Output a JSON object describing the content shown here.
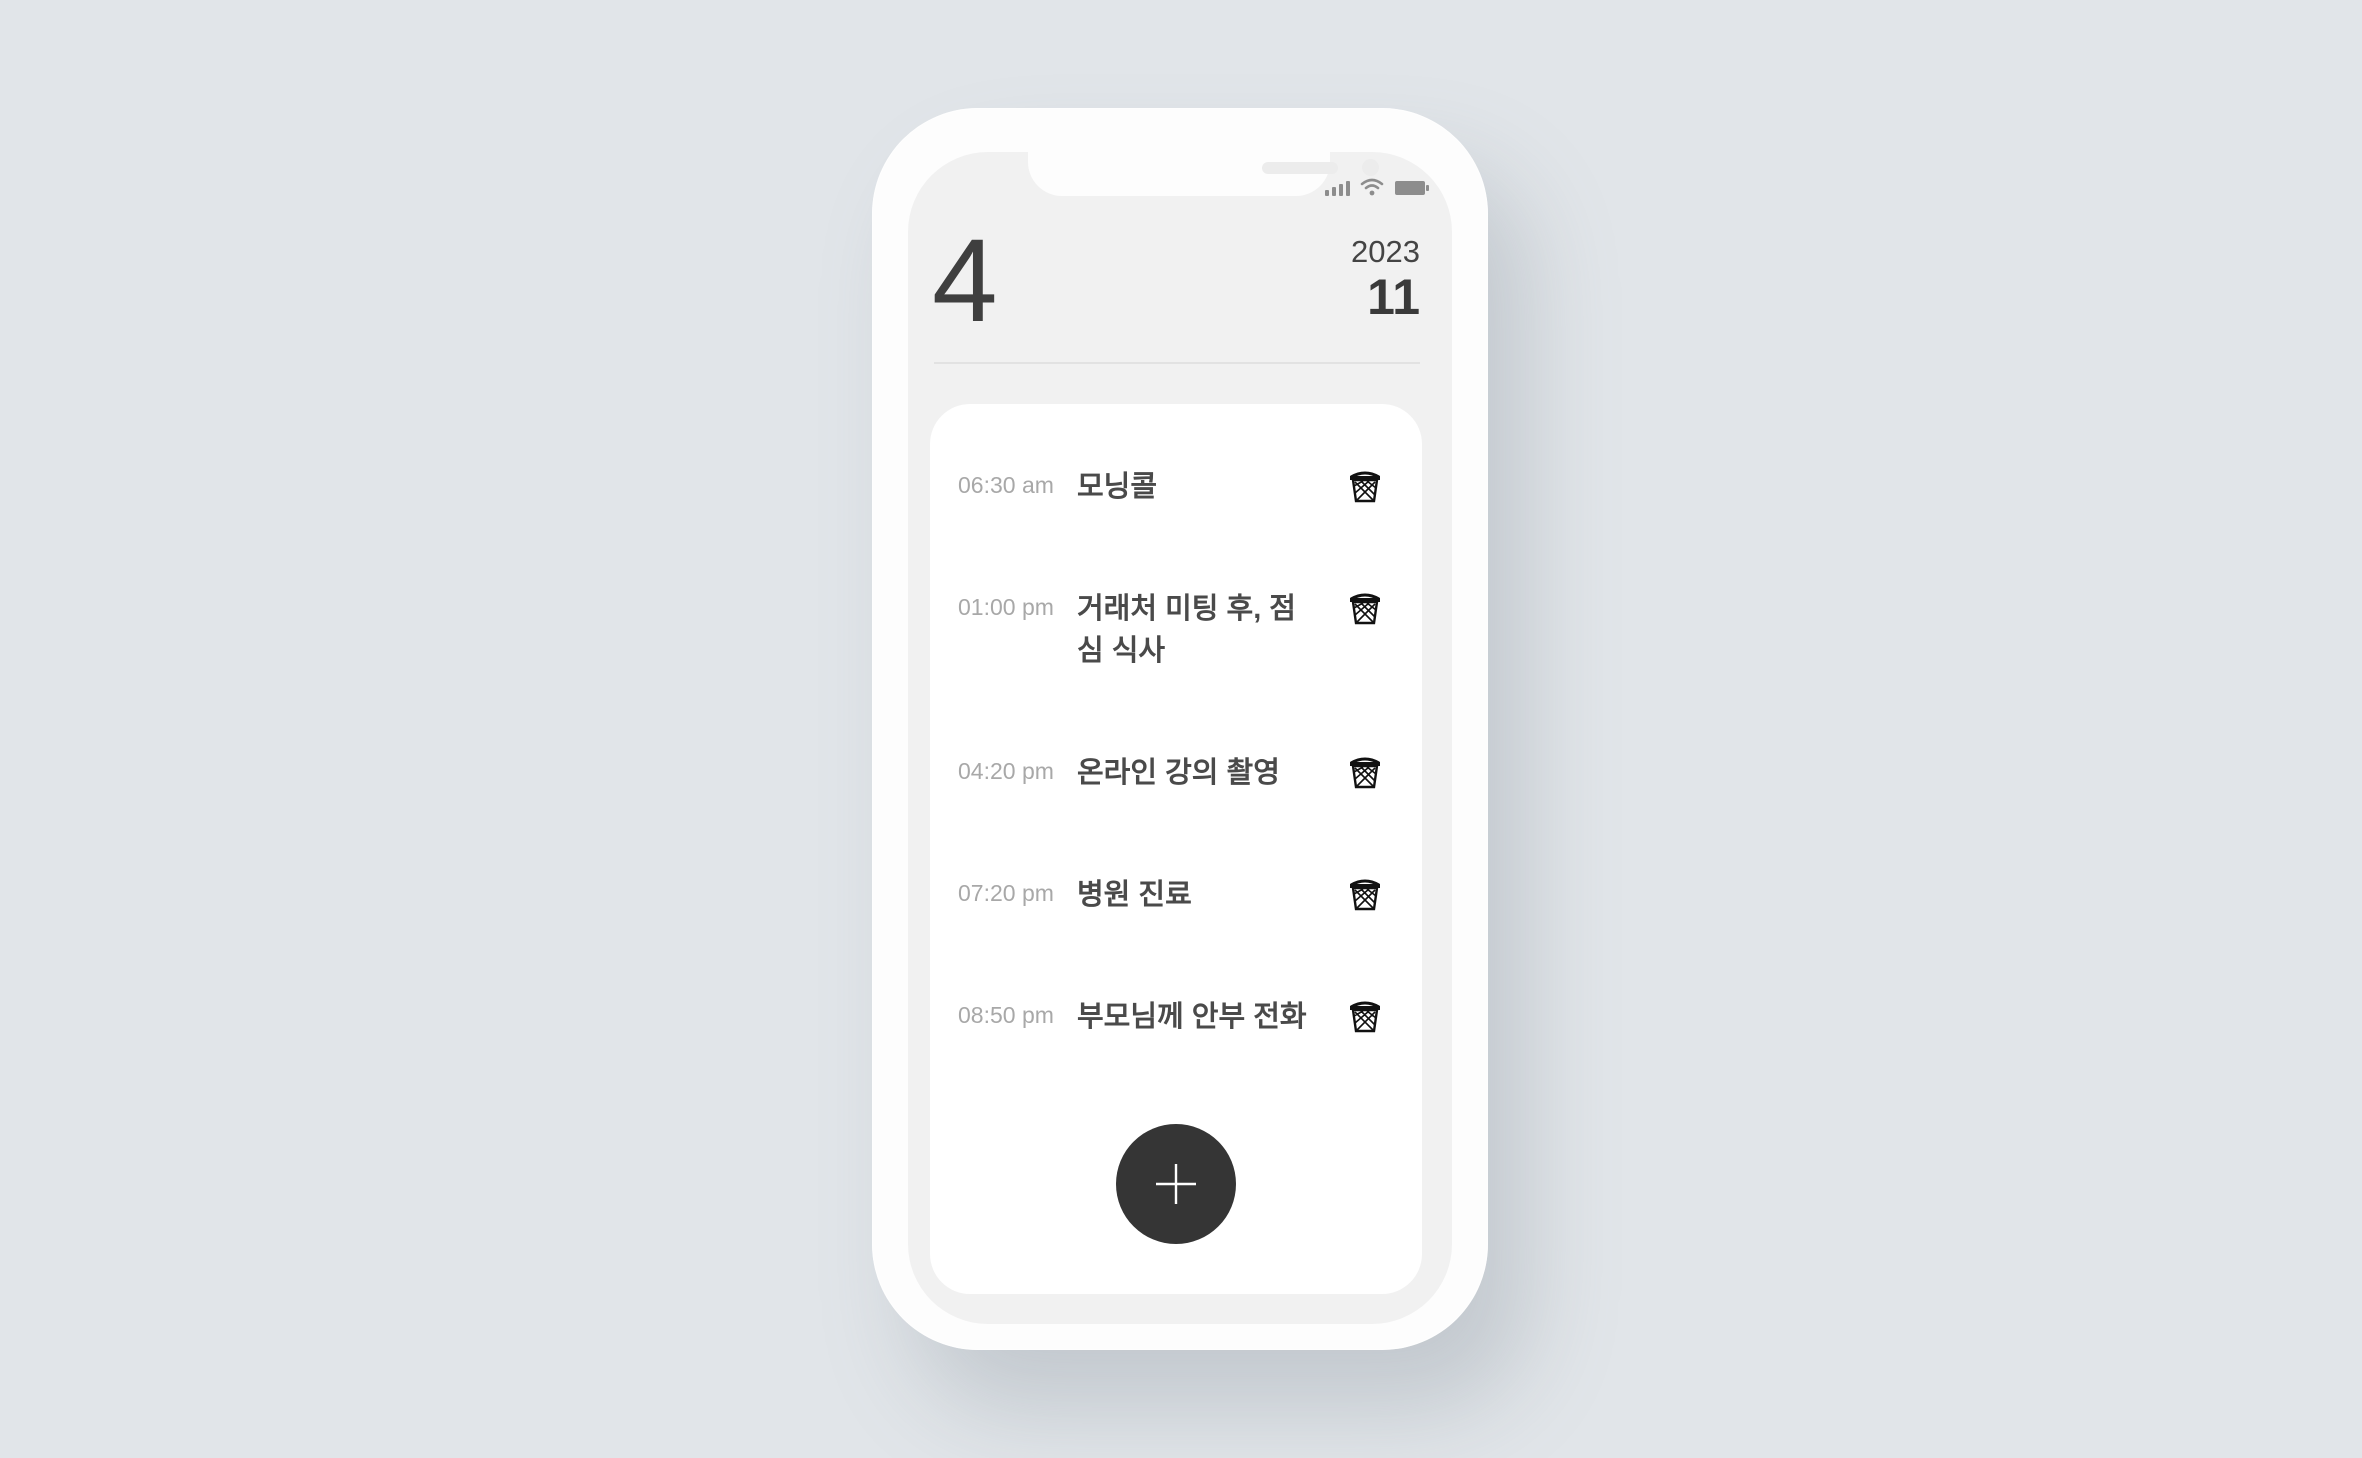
{
  "header": {
    "day": "4",
    "year": "2023",
    "month": "11"
  },
  "tasks": [
    {
      "time": "06:30 am",
      "title": "모닝콜"
    },
    {
      "time": "01:00 pm",
      "title": "거래처 미팅 후, 점심 식사"
    },
    {
      "time": "04:20 pm",
      "title": "온라인 강의 촬영"
    },
    {
      "time": "07:20 pm",
      "title": "병원 진료"
    },
    {
      "time": "08:50 pm",
      "title": "부모님께 안부 전화"
    }
  ],
  "icons": {
    "delete": "trash-icon",
    "add": "plus-icon",
    "status": [
      "signal-icon",
      "wifi-icon",
      "battery-icon"
    ]
  },
  "colors": {
    "background": "#e1e5e9",
    "screen": "#f1f1f1",
    "card": "#ffffff",
    "add_button": "#353535",
    "time_text": "#a8a8a8",
    "title_text": "#4a4a4a"
  }
}
